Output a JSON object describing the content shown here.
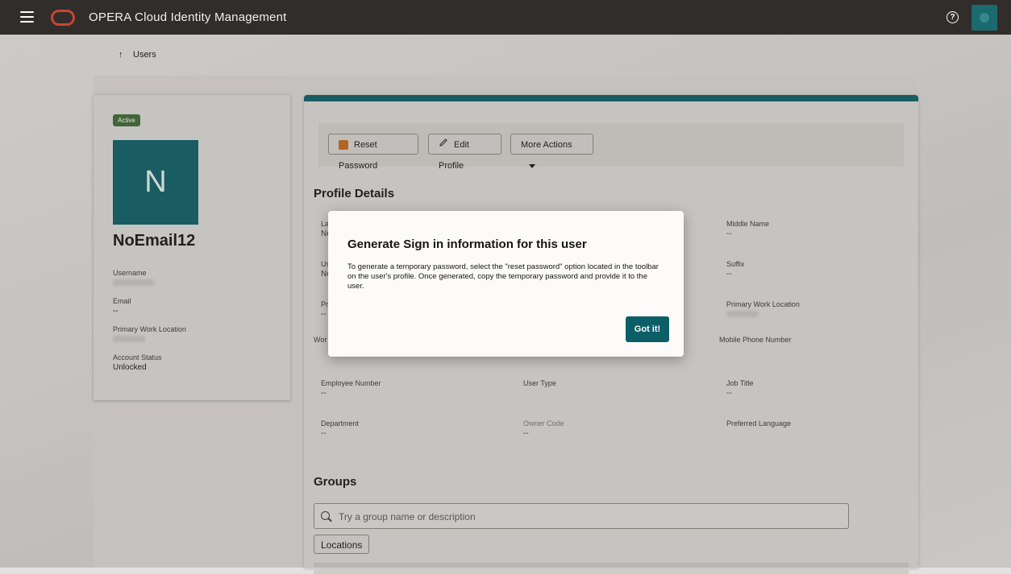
{
  "header": {
    "app_title": "OPERA Cloud Identity Management",
    "menu_icon": "hamburger-menu-icon",
    "logo_icon": "oracle-logo-icon",
    "help_icon": "help-icon",
    "help_glyph": "?",
    "user_avatar_icon": "user-avatar-icon"
  },
  "breadcrumb": {
    "label": "Users",
    "arrow": "↑"
  },
  "profile_card": {
    "status": "Active",
    "avatar_initial": "N",
    "name": "NoEmail12",
    "username_label": "Username",
    "email_label": "Email",
    "email_value": "--",
    "work_location_label": "Primary Work Location",
    "account_status_label": "Account Status",
    "account_status_value": "Unlocked"
  },
  "toolbar": {
    "reset_password": "Reset Password",
    "edit_profile": "Edit Profile",
    "more_actions": "More Actions"
  },
  "profile_details": {
    "title": "Profile Details",
    "fields": {
      "last_name_label": "La",
      "last_name_value": "No",
      "username_label": "Us",
      "username_value": "No",
      "pr_label": "Pr",
      "pr_value": "--",
      "work_label": "Wor",
      "middle_name_label": "Middle Name",
      "middle_name_value": "--",
      "suffix_label": "Suffix",
      "suffix_value": "--",
      "primary_work_location_label": "Primary Work Location",
      "mobile_phone_label": "Mobile Phone Number",
      "employee_number_label": "Employee Number",
      "employee_number_value": "--",
      "user_type_label": "User Type",
      "job_title_label": "Job Title",
      "job_title_value": "--",
      "department_label": "Department",
      "department_value": "--",
      "owner_code_label": "Owner Code",
      "owner_code_value": "--",
      "preferred_language_label": "Preferred Language"
    }
  },
  "groups": {
    "title": "Groups",
    "search_placeholder": "Try a group name or description",
    "chip_locations": "Locations"
  },
  "dialog": {
    "title": "Generate Sign in information for this user",
    "body": "To generate a temporary password, select the \"reset password\" option located in the toolbar on the user's profile. Once generated, copy the temporary password and provide it to the user.",
    "confirm": "Got it!"
  },
  "colors": {
    "header_bg": "#312d2a",
    "accent_teal": "#0c5f66",
    "oracle_red": "#c74634",
    "active_green": "#3d6b32"
  }
}
